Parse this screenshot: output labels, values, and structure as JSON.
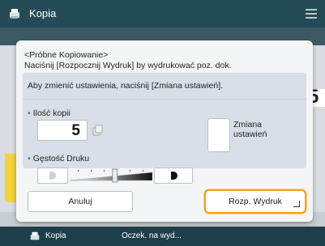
{
  "topbar": {
    "title": "Kopia",
    "app_icon": "copier-icon",
    "menu_icon": "menu-icon"
  },
  "background": {
    "big_value": "5"
  },
  "dialog": {
    "message_line1": "<Próbne Kopiowanie>",
    "message_line2": "Naciśnij [Rozpocznij Wydruk] by wydrukować poz. dok.",
    "info_text": "Aby zmienić ustawienia, naciśnij [Zmiana ustawień].",
    "copies_label": "Ilość kopii",
    "copies_value": "5",
    "change_label_line1": "Zmiana",
    "change_label_line2": "ustawień",
    "density_label": "Gęstość Druku",
    "density_level": 0.55,
    "cancel_label": "Anuluj",
    "print_label": "Rozp. Wydruk"
  },
  "statusbar": {
    "title": "Kopia",
    "message": "Oczek. na wyd..."
  },
  "colors": {
    "accent": "#f0a020",
    "header": "#244b57",
    "bullet": "#2d7fc2"
  }
}
